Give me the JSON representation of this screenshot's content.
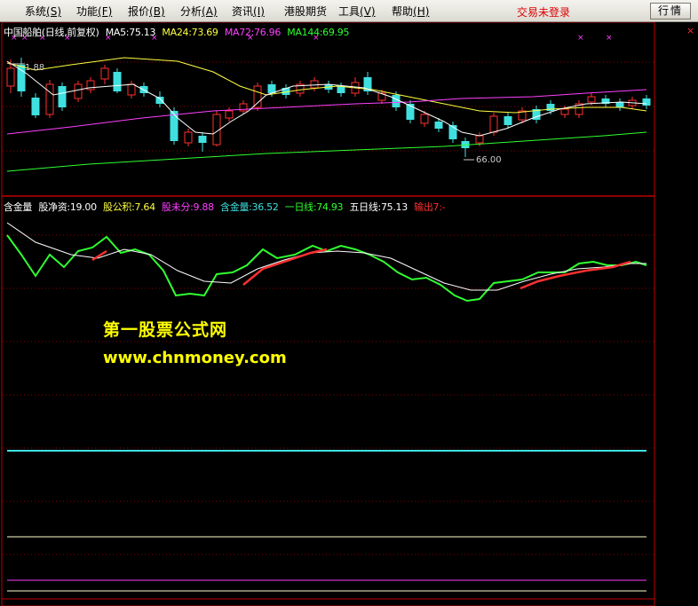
{
  "menu": {
    "items": [
      {
        "label": "系统",
        "key": "(S)"
      },
      {
        "label": "功能",
        "key": "(F)"
      },
      {
        "label": "报价",
        "key": "(B)"
      },
      {
        "label": "分析",
        "key": "(A)"
      },
      {
        "label": "资讯",
        "key": "(I)"
      },
      {
        "label": "港股期货",
        "key": ""
      },
      {
        "label": "工具",
        "key": "(V)"
      },
      {
        "label": "帮助",
        "key": "(H)"
      }
    ],
    "login_status": "交易未登录",
    "quote_button": "行情"
  },
  "main_legend": {
    "stock": "中国船舶(日线,前复权)",
    "ma5": "MA5:75.13",
    "ma24": "MA24:73.69",
    "ma72": "MA72:76.96",
    "ma144": "MA144:69.95"
  },
  "indicator_legend": {
    "name": "含金量",
    "net_assets": "股净资:19.00",
    "reserve": "股公积:7.64",
    "undistributed": "股未分:9.88",
    "gold_content": "含金量:36.52",
    "one_day_line": "一日线:74.93",
    "five_day_line": "五日线:75.13",
    "output": "输出7:-"
  },
  "price_labels": {
    "high": "1.88",
    "low": "66.00"
  },
  "close_icon": "×",
  "watermark": {
    "title": "第一股票公式网",
    "url": "www.chnmoney.com"
  },
  "colors": {
    "up": "#ff3030",
    "down": "#40e0e0",
    "ma5": "#ffffff",
    "ma24": "#ffff40",
    "ma72": "#ff40ff",
    "ma144": "#30ff30",
    "divider": "#c00000"
  }
}
